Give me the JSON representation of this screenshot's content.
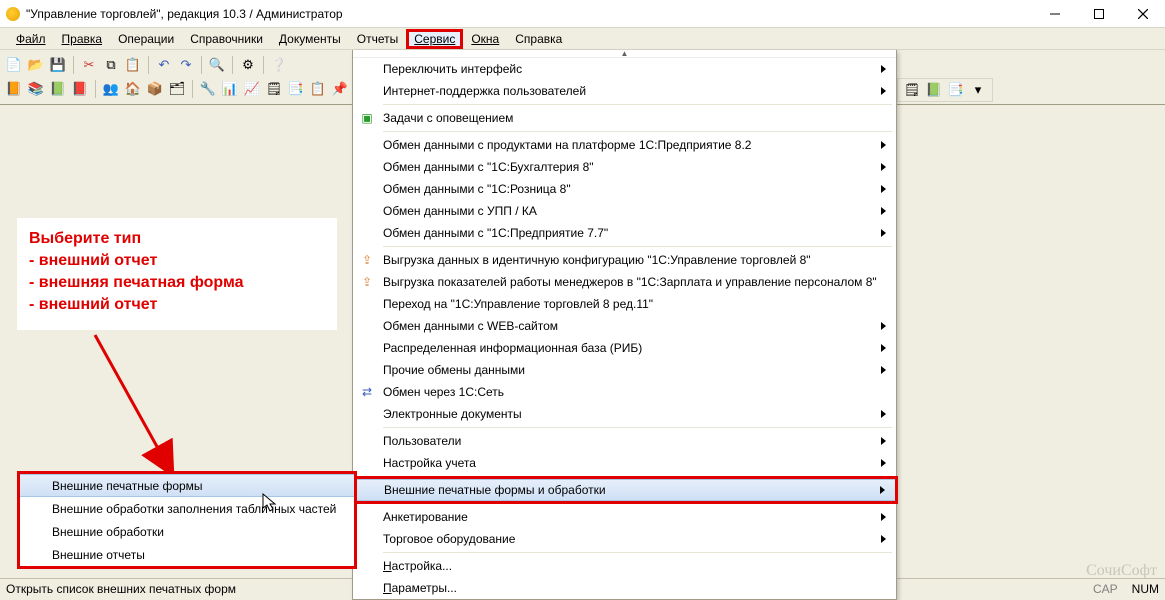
{
  "window": {
    "title": "\"Управление торговлей\", редакция 10.3 / Администратор"
  },
  "menu": {
    "items": [
      "Файл",
      "Правка",
      "Операции",
      "Справочники",
      "Документы",
      "Отчеты",
      "Сервис",
      "Окна",
      "Справка"
    ],
    "active_index": 6
  },
  "dropdown": {
    "items": [
      {
        "label": "Переключить интерфейс",
        "sub": true
      },
      {
        "label": "Интернет-поддержка пользователей",
        "sub": true
      },
      {
        "sep": true
      },
      {
        "label": "Задачи с оповещением",
        "icon": "task-icon",
        "icon_color": "ic-green"
      },
      {
        "sep": true
      },
      {
        "label": "Обмен данными с продуктами на платформе 1С:Предприятие 8.2",
        "sub": true
      },
      {
        "label": "Обмен данными с \"1С:Бухгалтерия 8\"",
        "sub": true
      },
      {
        "label": "Обмен данными с \"1С:Розница 8\"",
        "sub": true
      },
      {
        "label": "Обмен данными с УПП / КА",
        "sub": true
      },
      {
        "label": "Обмен данными с \"1С:Предприятие 7.7\"",
        "sub": true
      },
      {
        "sep": true
      },
      {
        "label": "Выгрузка данных в идентичную конфигурацию \"1С:Управление торговлей 8\"",
        "icon": "export-icon",
        "icon_color": "ic-orange"
      },
      {
        "label": "Выгрузка показателей работы менеджеров в \"1С:Зарплата и управление персоналом 8\"",
        "icon": "export-icon",
        "icon_color": "ic-orange"
      },
      {
        "label": "Переход на \"1С:Управление торговлей 8 ред.11\""
      },
      {
        "label": "Обмен данными с WEB-сайтом",
        "sub": true
      },
      {
        "label": "Распределенная информационная база (РИБ)",
        "sub": true
      },
      {
        "label": "Прочие обмены данными",
        "sub": true
      },
      {
        "label": "Обмен через 1С:Сеть",
        "icon": "net-icon",
        "icon_color": "ic-blue"
      },
      {
        "label": "Электронные документы",
        "sub": true
      },
      {
        "sep": true
      },
      {
        "label": "Пользователи",
        "sub": true
      },
      {
        "label": "Настройка учета",
        "sub": true
      },
      {
        "highlight": true,
        "label": "Внешние печатные формы и обработки",
        "sub": true
      },
      {
        "label": "Анкетирование",
        "sub": true
      },
      {
        "label": "Торговое оборудование",
        "sub": true
      },
      {
        "sep": true
      },
      {
        "label": "Настройка...",
        "ul": 0
      },
      {
        "label": "Параметры...",
        "ul": 0
      }
    ]
  },
  "submenu": {
    "items": [
      {
        "label": "Внешние печатные формы",
        "active": true
      },
      {
        "label": "Внешние обработки заполнения табличных частей"
      },
      {
        "label": "Внешние обработки"
      },
      {
        "label": "Внешние отчеты"
      }
    ]
  },
  "annotation": {
    "lines": [
      "Выберите тип",
      "- внешний отчет",
      "- внешняя печатная форма",
      "- внешний отчет"
    ]
  },
  "statusbar": {
    "hint": "Открыть список внешних печатных форм",
    "cap": "CAP",
    "num": "NUM"
  },
  "watermark": "СочиСофт"
}
